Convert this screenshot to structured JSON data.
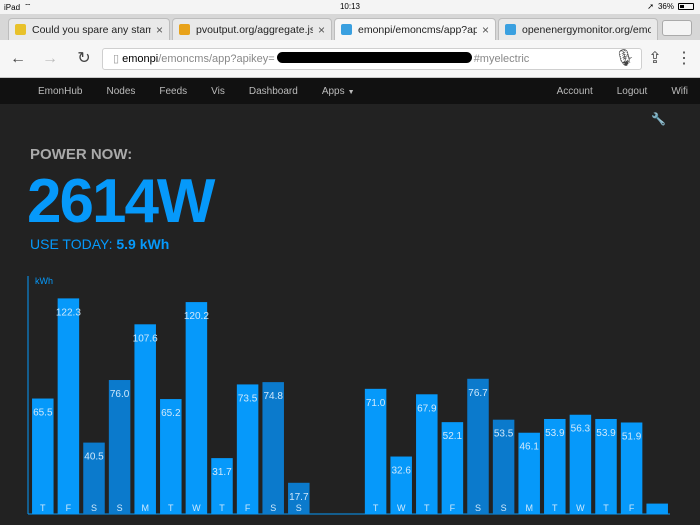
{
  "statusbar": {
    "device": "iPad",
    "time": "10:13",
    "battery": "36%",
    "battery_level": 0.36
  },
  "tabs": [
    {
      "title": "Could you spare any stamps",
      "favicon_color": "#e8c12a",
      "active": false
    },
    {
      "title": "pvoutput.org/aggregate.jsp",
      "favicon_color": "#e8a21a",
      "active": false
    },
    {
      "title": "emonpi/emoncms/app?apikey",
      "favicon_color": "#3aa0e0",
      "active": true
    },
    {
      "title": "openenergymonitor.org/emon",
      "favicon_color": "#3aa0e0",
      "active": false
    }
  ],
  "omnibox": {
    "host": "emonpi",
    "path": "/emoncms/app?apikey=",
    "hash": "#myelectric"
  },
  "nav": {
    "left": [
      "EmonHub",
      "Nodes",
      "Feeds",
      "Vis",
      "Dashboard",
      "Apps"
    ],
    "right": [
      "Account",
      "Logout",
      "Wifi"
    ]
  },
  "power": {
    "label": "POWER NOW:",
    "value": "2614W",
    "use_label": "USE TODAY:",
    "use_value": "5.9 kWh"
  },
  "colors": {
    "accent": "#0699fa",
    "bar_alt": "#0b7acc",
    "axis": "#0699fa"
  },
  "chart_data": {
    "type": "bar",
    "ylabel": "kWh",
    "ylim": [
      0,
      135
    ],
    "categories": [
      "T",
      "F",
      "S",
      "S",
      "M",
      "T",
      "W",
      "T",
      "F",
      "S",
      "S",
      "",
      "",
      "T",
      "W",
      "T",
      "F",
      "S",
      "S",
      "M",
      "T",
      "W",
      "T",
      "F",
      ""
    ],
    "values": [
      65.5,
      122.3,
      40.5,
      76.0,
      107.6,
      65.2,
      120.2,
      31.7,
      73.5,
      74.8,
      17.7,
      null,
      null,
      71.0,
      32.6,
      67.9,
      52.1,
      76.7,
      53.5,
      46.1,
      53.9,
      56.3,
      53.9,
      51.9,
      5.9
    ],
    "labels": [
      "65.5",
      "122.3",
      "40.5",
      "76.0",
      "107.6",
      "65.2",
      "120.2",
      "31.7",
      "73.5",
      "74.8",
      "17.7",
      "",
      "",
      "71.0",
      "32.6",
      "67.9",
      "52.1",
      "76.7",
      "53.5",
      "46.1",
      "53.9",
      "56.3",
      "53.9",
      "51.9",
      ""
    ],
    "weekend": [
      false,
      false,
      true,
      true,
      false,
      false,
      false,
      false,
      false,
      true,
      true,
      false,
      false,
      false,
      false,
      false,
      false,
      true,
      true,
      false,
      false,
      false,
      false,
      false,
      false
    ]
  }
}
